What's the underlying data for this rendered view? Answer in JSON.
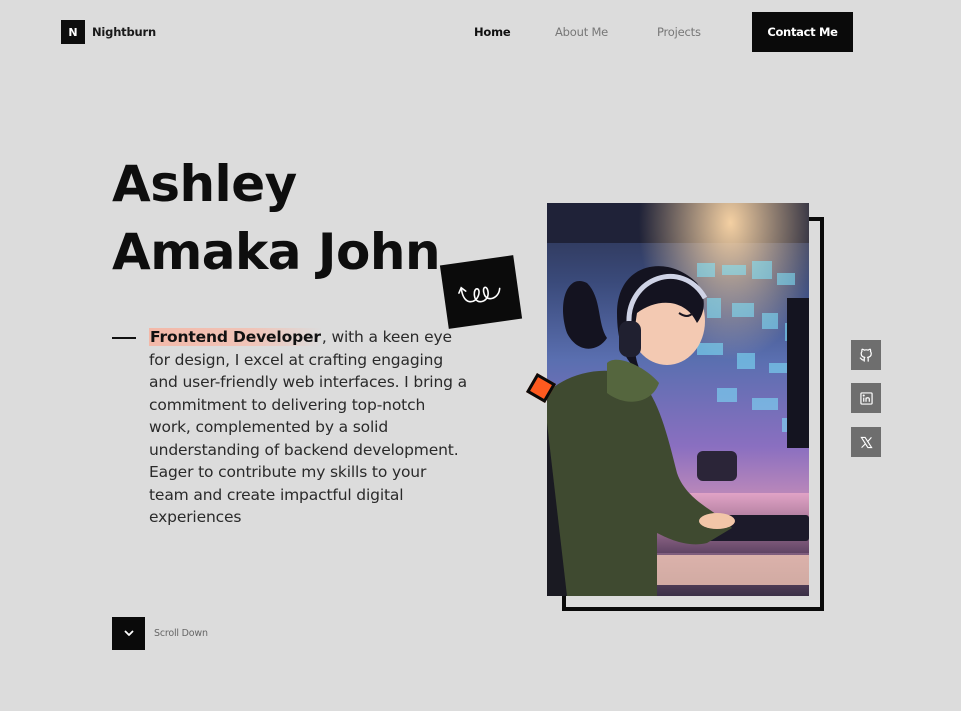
{
  "brand": {
    "logo_letter": "N",
    "name": "Nightburn"
  },
  "nav": {
    "home": "Home",
    "about": "About Me",
    "projects": "Projects",
    "contact": "Contact Me"
  },
  "hero": {
    "name_line1": "Ashley",
    "name_line2": "Amaka John",
    "role": "Frontend Developer",
    "bio_rest": ", with a keen eye for design, I excel at crafting engaging and user-friendly web interfaces. I bring a commitment to delivering top-notch work, complemented by a solid understanding of backend development. Eager to contribute my skills to your team and create impactful digital experiences"
  },
  "scroll": {
    "label": "Scroll Down"
  },
  "icons": {
    "brand": "brand-logo-icon",
    "spring": "spring-doodle-icon",
    "scroll": "chevron-down-icon",
    "github": "github-icon",
    "linkedin": "linkedin-icon",
    "x": "x-icon"
  },
  "colors": {
    "background": "#dcdcdc",
    "primary": "#0a0a0a",
    "accent": "#ff5a1f",
    "highlight": "#f3b8a8",
    "social": "#6e6e6e"
  }
}
